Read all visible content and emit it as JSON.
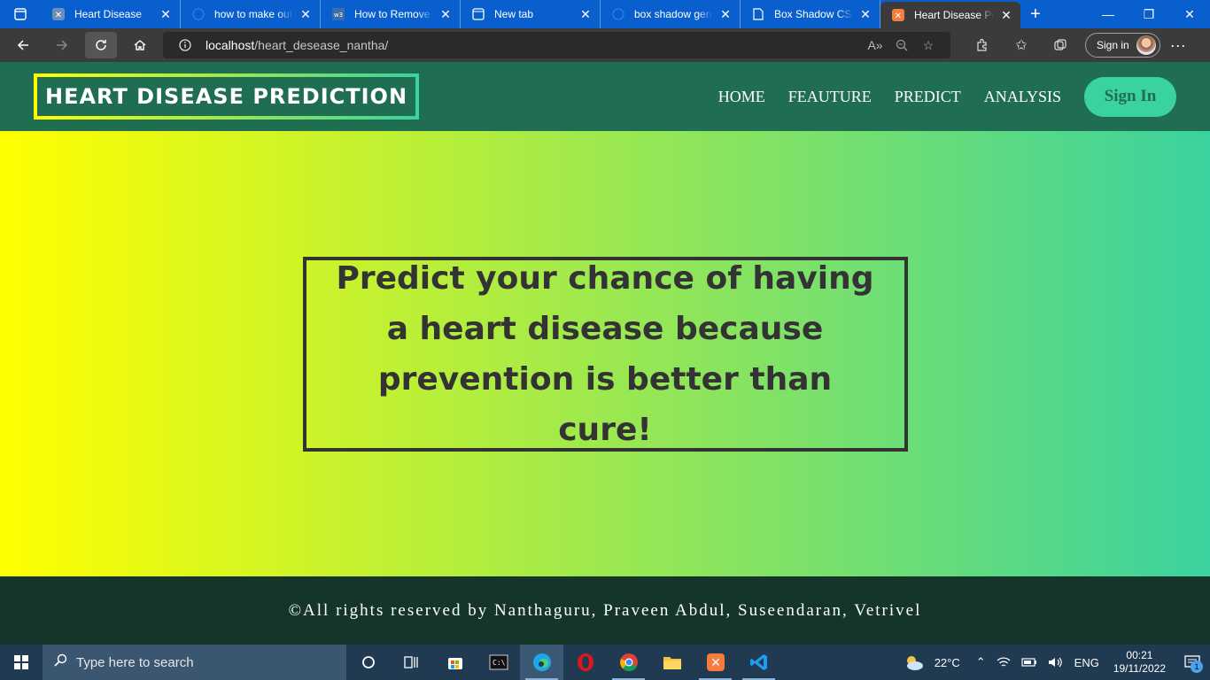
{
  "browser": {
    "tabs": [
      {
        "title": "Heart Disease",
        "icon": "xampp-icon",
        "active": false
      },
      {
        "title": "how to make outline",
        "icon": "web-icon",
        "active": false
      },
      {
        "title": "How to Remove Outline",
        "icon": "w3-icon",
        "active": false
      },
      {
        "title": "New tab",
        "icon": "newtab-icon",
        "active": false
      },
      {
        "title": "box shadow generator",
        "icon": "web-icon",
        "active": false
      },
      {
        "title": "Box Shadow CSS",
        "icon": "page-icon",
        "active": false
      },
      {
        "title": "Heart Disease Prediction",
        "icon": "xampp-icon",
        "active": true
      }
    ],
    "url_host": "localhost",
    "url_path": "/heart_desease_nantha/",
    "signin_label": "Sign in"
  },
  "site": {
    "logo": "HEART DISEASE PREDICTION",
    "nav": [
      "HOME",
      "FEAUTURE",
      "PREDICT",
      "ANALYSIS"
    ],
    "signin_button": "Sign In",
    "hero_text": "Predict your chance of having a heart disease because prevention is better than cure!",
    "footer_text": "©All rights reserved by Nanthaguru, Praveen Abdul, Suseendaran, Vetrivel",
    "colors": {
      "header": "#1f6e52",
      "gradient_start": "#ffff00",
      "gradient_end": "#3ad29f",
      "footer": "#15352a",
      "accent": "#3ad29f"
    }
  },
  "taskbar": {
    "search_placeholder": "Type here to search",
    "weather": "22°C",
    "language": "ENG",
    "time": "00:21",
    "date": "19/11/2022",
    "notification_count": "1"
  }
}
